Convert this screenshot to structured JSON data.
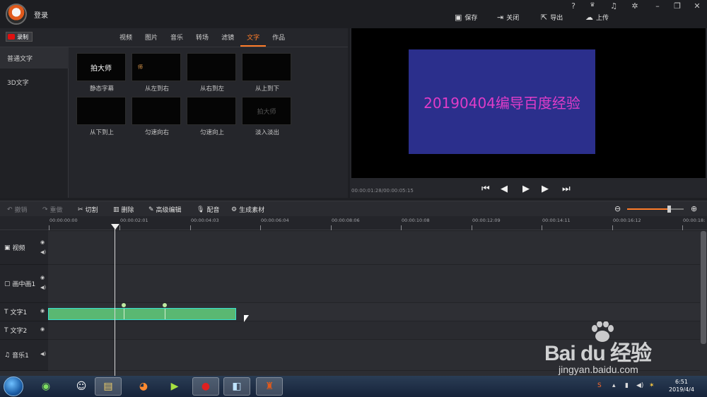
{
  "header": {
    "login_label": "登录",
    "actions": [
      {
        "label": "保存",
        "icon": "save-icon"
      },
      {
        "label": "关闭",
        "icon": "exit-icon"
      },
      {
        "label": "导出",
        "icon": "export-icon"
      },
      {
        "label": "上传",
        "icon": "upload-icon"
      }
    ],
    "window_controls": [
      "?",
      "VIP",
      "bell",
      "gear",
      "minimize",
      "restore",
      "close"
    ]
  },
  "record_button": "录制",
  "tabs": [
    "视频",
    "图片",
    "音乐",
    "转场",
    "滤镜",
    "文字",
    "作品"
  ],
  "active_tab": "文字",
  "sidebar": [
    "普通文字",
    "3D文字"
  ],
  "effects": [
    {
      "label": "静态字幕",
      "thumb_text": "拍大师"
    },
    {
      "label": "从左到右",
      "thumb_text": "师"
    },
    {
      "label": "从右到左",
      "thumb_text": ""
    },
    {
      "label": "从上到下",
      "thumb_text": ""
    },
    {
      "label": "从下到上",
      "thumb_text": ""
    },
    {
      "label": "匀速向右",
      "thumb_text": ""
    },
    {
      "label": "匀速向上",
      "thumb_text": ""
    },
    {
      "label": "淡入淡出",
      "thumb_text": "拍大师"
    }
  ],
  "preview": {
    "overlay_text": "20190404编导百度经验",
    "time": "00:00:01:28/00:00:05:15",
    "slide_color": "#2b2f8c",
    "text_color": "#e03cc8"
  },
  "toolbar": [
    "撤销",
    "重做",
    "切割",
    "删除",
    "高级编辑",
    "配音",
    "生成素材"
  ],
  "timeline_ticks": [
    "00:00:00:00",
    "00:00:02:01",
    "00:00:04:03",
    "00:00:06:04",
    "00:00:08:06",
    "00:00:10:08",
    "00:00:12:09",
    "00:00:14:11",
    "00:00:16:12",
    "00:00:18:"
  ],
  "tracks": [
    "视频",
    "画中画1",
    "文字1",
    "文字2",
    "音乐1"
  ],
  "watermark": {
    "logo": "Bai du 经验",
    "url": "jingyan.baidu.com"
  },
  "clock": {
    "time": "6:51",
    "date": "2019/4/4"
  },
  "accent_color": "#ff7d2a"
}
